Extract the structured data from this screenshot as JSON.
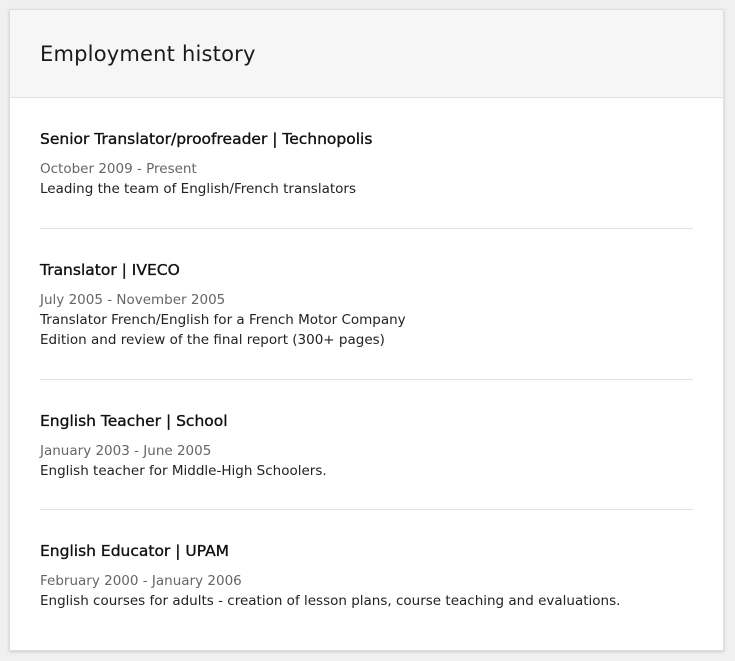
{
  "section": {
    "title": "Employment history"
  },
  "jobs": [
    {
      "title": "Senior Translator/proofreader | Technopolis",
      "dates": "October 2009 - Present",
      "description": [
        "Leading the team of English/French translators"
      ]
    },
    {
      "title": "Translator | IVECO",
      "dates": "July 2005 - November 2005",
      "description": [
        "Translator French/English for a French Motor Company",
        "Edition and review of the final report (300+ pages)"
      ]
    },
    {
      "title": "English Teacher | School",
      "dates": "January 2003 - June 2005",
      "description": [
        "English teacher for Middle-High Schoolers."
      ]
    },
    {
      "title": "English Educator | UPAM",
      "dates": "February 2000 - January 2006",
      "description": [
        "English courses for adults - creation of lesson plans, course teaching and evaluations."
      ]
    }
  ]
}
